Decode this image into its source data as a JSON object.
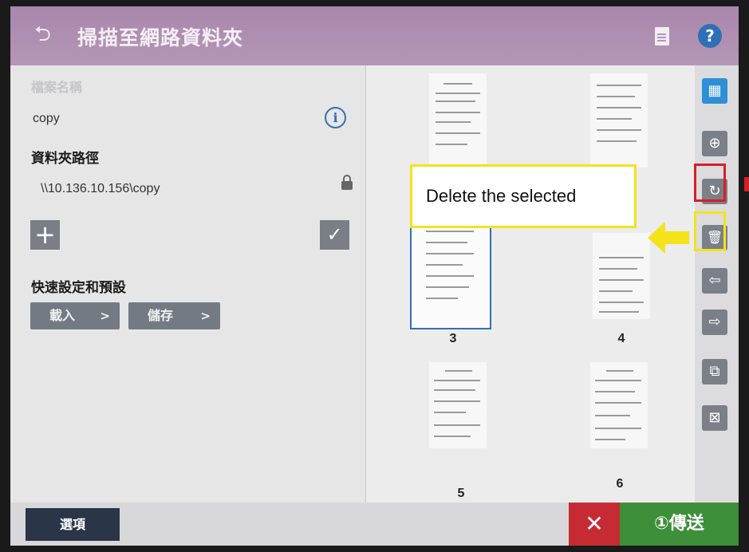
{
  "title_bar": {
    "back_icon": "undo-arrow-icon",
    "title": "掃描至網路資料夾",
    "document_icon": "document-icon",
    "help_icon": "help-icon",
    "help_glyph": "?"
  },
  "left_panel": {
    "file_name_label": "檔案名稱",
    "file_name_value": "copy",
    "info_glyph": "i",
    "folder_path_label": "資料夾路徑",
    "folder_path_value": "\\\\10.136.10.156\\copy",
    "add_glyph": "+",
    "confirm_glyph": "✓",
    "quick_sets_label": "快速設定和預設",
    "load_label": "載入",
    "save_label": "儲存",
    "chevron": ">"
  },
  "preview": {
    "pages": [
      "3",
      "4",
      "5",
      "6"
    ],
    "selected_page": "3"
  },
  "toolbar": {
    "items": [
      {
        "name": "thumbnail-view-icon",
        "glyph": "▦",
        "active": true
      },
      {
        "name": "zoom-in-icon",
        "glyph": "⊕"
      },
      {
        "name": "rotate-icon",
        "glyph": "↻"
      },
      {
        "name": "delete-icon",
        "glyph": "🗑"
      },
      {
        "name": "move-left-icon",
        "glyph": "⇦"
      },
      {
        "name": "move-right-icon",
        "glyph": "⇨"
      },
      {
        "name": "copy-page-icon",
        "glyph": "⧉"
      },
      {
        "name": "close-preview-icon",
        "glyph": "⊠"
      }
    ]
  },
  "bottom_bar": {
    "options_label": "選項",
    "cancel_glyph": "✕",
    "send_label": "①傳送"
  },
  "annotation": {
    "callout_text": "Delete the selected"
  },
  "colors": {
    "title_bar": "#b497b5",
    "accent_blue": "#2f6fb5",
    "send_green": "#3d8f3a",
    "cancel_red": "#c62b34",
    "highlight_yellow": "#f2e31b",
    "highlight_red": "#d61f26"
  }
}
